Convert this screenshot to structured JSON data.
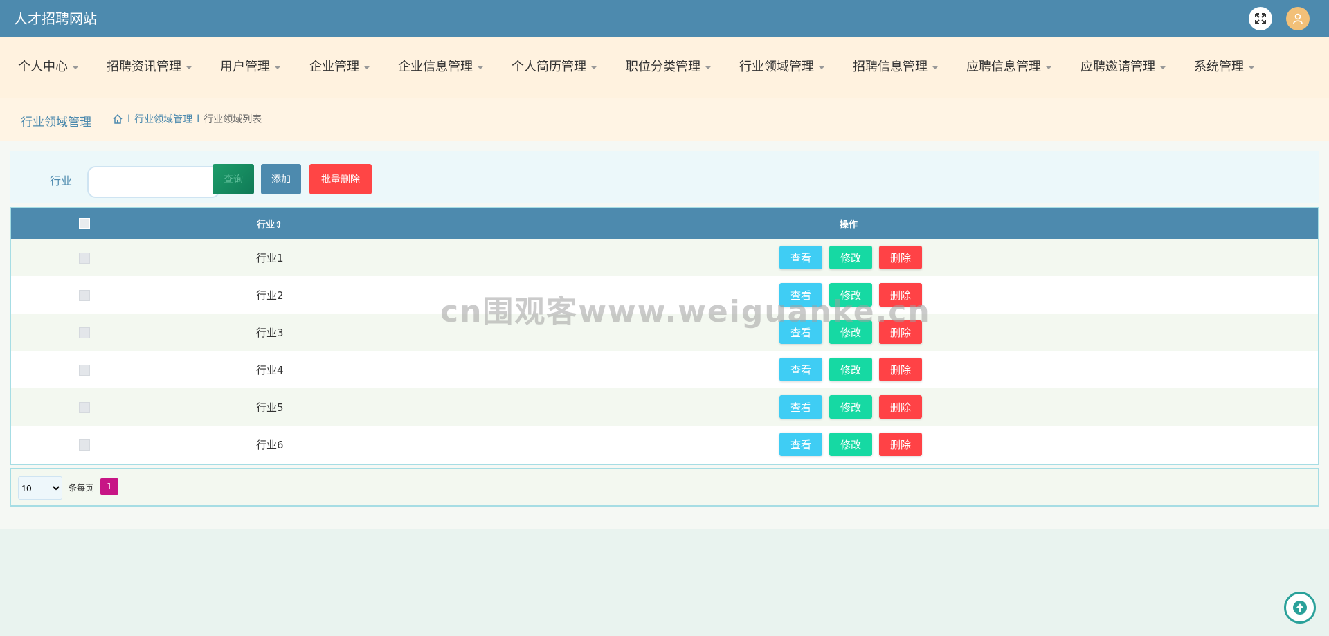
{
  "site": {
    "title": "人才招聘网站"
  },
  "topbar": {
    "fullscreen_icon": "expand-arrows-icon",
    "user_icon": "user-icon"
  },
  "nav": {
    "items": [
      {
        "label": "个人中心"
      },
      {
        "label": "招聘资讯管理"
      },
      {
        "label": "用户管理"
      },
      {
        "label": "企业管理"
      },
      {
        "label": "企业信息管理"
      },
      {
        "label": "个人简历管理"
      },
      {
        "label": "职位分类管理"
      },
      {
        "label": "行业领域管理"
      },
      {
        "label": "招聘信息管理"
      },
      {
        "label": "应聘信息管理"
      },
      {
        "label": "应聘邀请管理"
      },
      {
        "label": "系统管理"
      }
    ]
  },
  "breadcrumb": {
    "page_title": "行业领域管理",
    "sep": "I",
    "level1": "行业领域管理",
    "level2": "行业领域列表"
  },
  "search": {
    "label": "行业",
    "input_value": "",
    "search_label": "查询",
    "add_label": "添加",
    "batch_delete_label": "批量删除"
  },
  "table": {
    "headers": {
      "name": "行业",
      "sort_icon": "sort-icon",
      "ops": "操作"
    },
    "rows": [
      {
        "name": "行业1"
      },
      {
        "name": "行业2"
      },
      {
        "name": "行业3"
      },
      {
        "name": "行业4"
      },
      {
        "name": "行业5"
      },
      {
        "name": "行业6"
      }
    ],
    "actions": {
      "view": "查看",
      "edit": "修改",
      "delete": "删除"
    }
  },
  "pagination": {
    "page_size": "10",
    "page_size_options": [
      "10"
    ],
    "per_page_label": "条每页",
    "current_page": "1"
  },
  "watermark": "cn围观客www.weiguanke.cn",
  "colors": {
    "topbar": "#4d8aae",
    "nav_bg": "#fff2df",
    "table_header": "#4d8aae",
    "view_button": "#3fcdf4",
    "edit_button": "#16d9a3",
    "delete_button": "#ff4246",
    "page_active": "#c71585"
  }
}
